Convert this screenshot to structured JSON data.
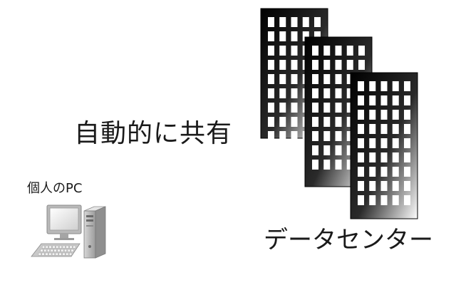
{
  "share_text": "自動的に共有",
  "pc_text": "個人のPC",
  "datacenter_text": "データセンター",
  "icons": {
    "datacenter": "office-building-icon",
    "pc": "desktop-computer-icon"
  },
  "colors": {
    "building_dark": "#000000",
    "building_light": "#ffffff",
    "window": "#ffffff",
    "text": "#1a1a1a"
  }
}
